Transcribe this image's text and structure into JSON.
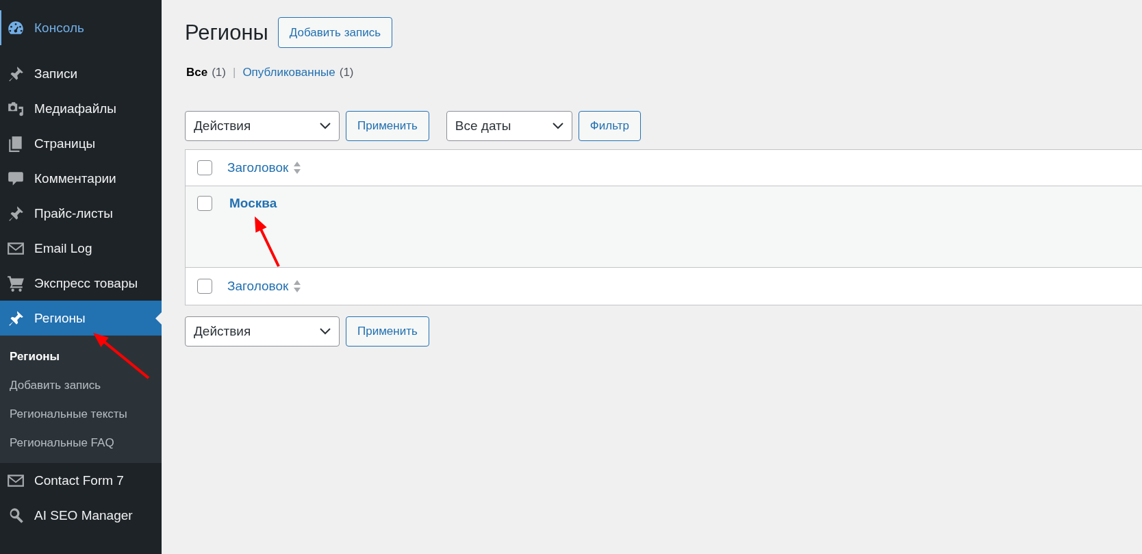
{
  "sidebar": {
    "items": [
      {
        "label": "Консоль",
        "kind": "gauge",
        "selected": false,
        "hover": true
      },
      {
        "label": "Записи",
        "kind": "pin",
        "selected": false,
        "hover": false
      },
      {
        "label": "Медиафайлы",
        "kind": "media",
        "selected": false,
        "hover": false
      },
      {
        "label": "Страницы",
        "kind": "pages",
        "selected": false,
        "hover": false
      },
      {
        "label": "Комментарии",
        "kind": "bubble",
        "selected": false,
        "hover": false
      },
      {
        "label": "Прайс-листы",
        "kind": "pin",
        "selected": false,
        "hover": false
      },
      {
        "label": "Email Log",
        "kind": "envelope",
        "selected": false,
        "hover": false
      },
      {
        "label": "Экспресс товары",
        "kind": "cart",
        "selected": false,
        "hover": false
      },
      {
        "label": "Регионы",
        "kind": "pin",
        "selected": true,
        "hover": false,
        "submenu": [
          {
            "label": "Регионы",
            "selected": true
          },
          {
            "label": "Добавить запись",
            "selected": false
          },
          {
            "label": "Региональные тексты",
            "selected": false
          },
          {
            "label": "Региональные FAQ",
            "selected": false
          }
        ]
      },
      {
        "label": "Contact Form 7",
        "kind": "envelope",
        "selected": false,
        "hover": false
      },
      {
        "label": "AI SEO Manager",
        "kind": "search",
        "selected": false,
        "hover": false
      }
    ]
  },
  "page": {
    "title": "Регионы",
    "add_button": "Добавить запись"
  },
  "filter_separator": "|",
  "filters": [
    {
      "label": "Все",
      "count": "(1)",
      "selected": true
    },
    {
      "label": "Опубликованные",
      "count": "(1)",
      "selected": false
    }
  ],
  "top_toolbar": {
    "actions": "Действия",
    "apply": "Применить",
    "dates": "Все даты",
    "filter": "Фильтр"
  },
  "table": {
    "header": "Заголовок",
    "header_checked": false,
    "footer_checked": false,
    "rows": [
      {
        "title": "Москва",
        "checked": false
      }
    ],
    "footer": "Заголовок"
  },
  "bottom_toolbar": {
    "actions": "Действия",
    "apply": "Применить"
  },
  "annotations": [
    {
      "kind": "arrow",
      "color": "#ff0000"
    },
    {
      "kind": "arrow",
      "color": "#ff0000"
    }
  ]
}
